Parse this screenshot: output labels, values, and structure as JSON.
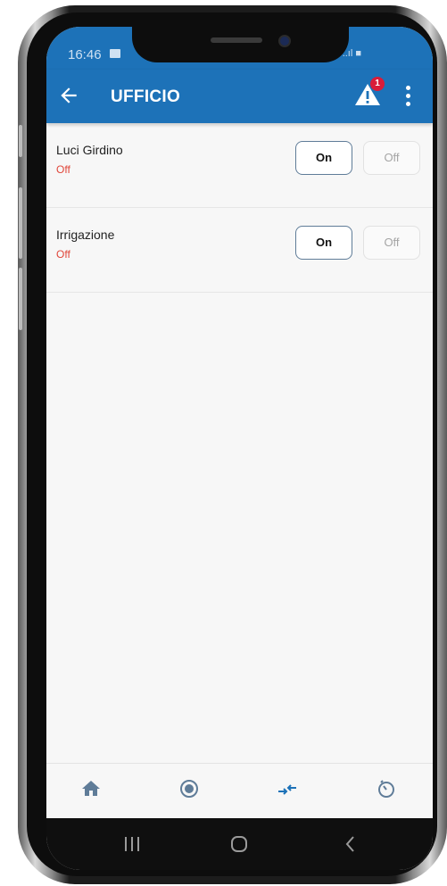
{
  "status_bar": {
    "time": "16:46",
    "right_indicators": "..ıl ■"
  },
  "app_bar": {
    "title": "UFFICIO",
    "alert_count": "1"
  },
  "devices": [
    {
      "name": "Luci Girdino",
      "status": "Off",
      "on_label": "On",
      "off_label": "Off"
    },
    {
      "name": "Irrigazione",
      "status": "Off",
      "on_label": "On",
      "off_label": "Off"
    }
  ],
  "bottom_nav": {
    "items": [
      "home-icon",
      "record-icon",
      "transfer-icon",
      "timer-icon"
    ],
    "active_color": "#1d72b8",
    "inactive_color": "#5f7c98"
  },
  "system_nav": {
    "items": [
      "recents-icon",
      "home-button-icon",
      "back-nav-icon"
    ]
  },
  "colors": {
    "primary": "#1d72b8",
    "off_status": "#e0463a",
    "badge": "#d91c3a"
  }
}
